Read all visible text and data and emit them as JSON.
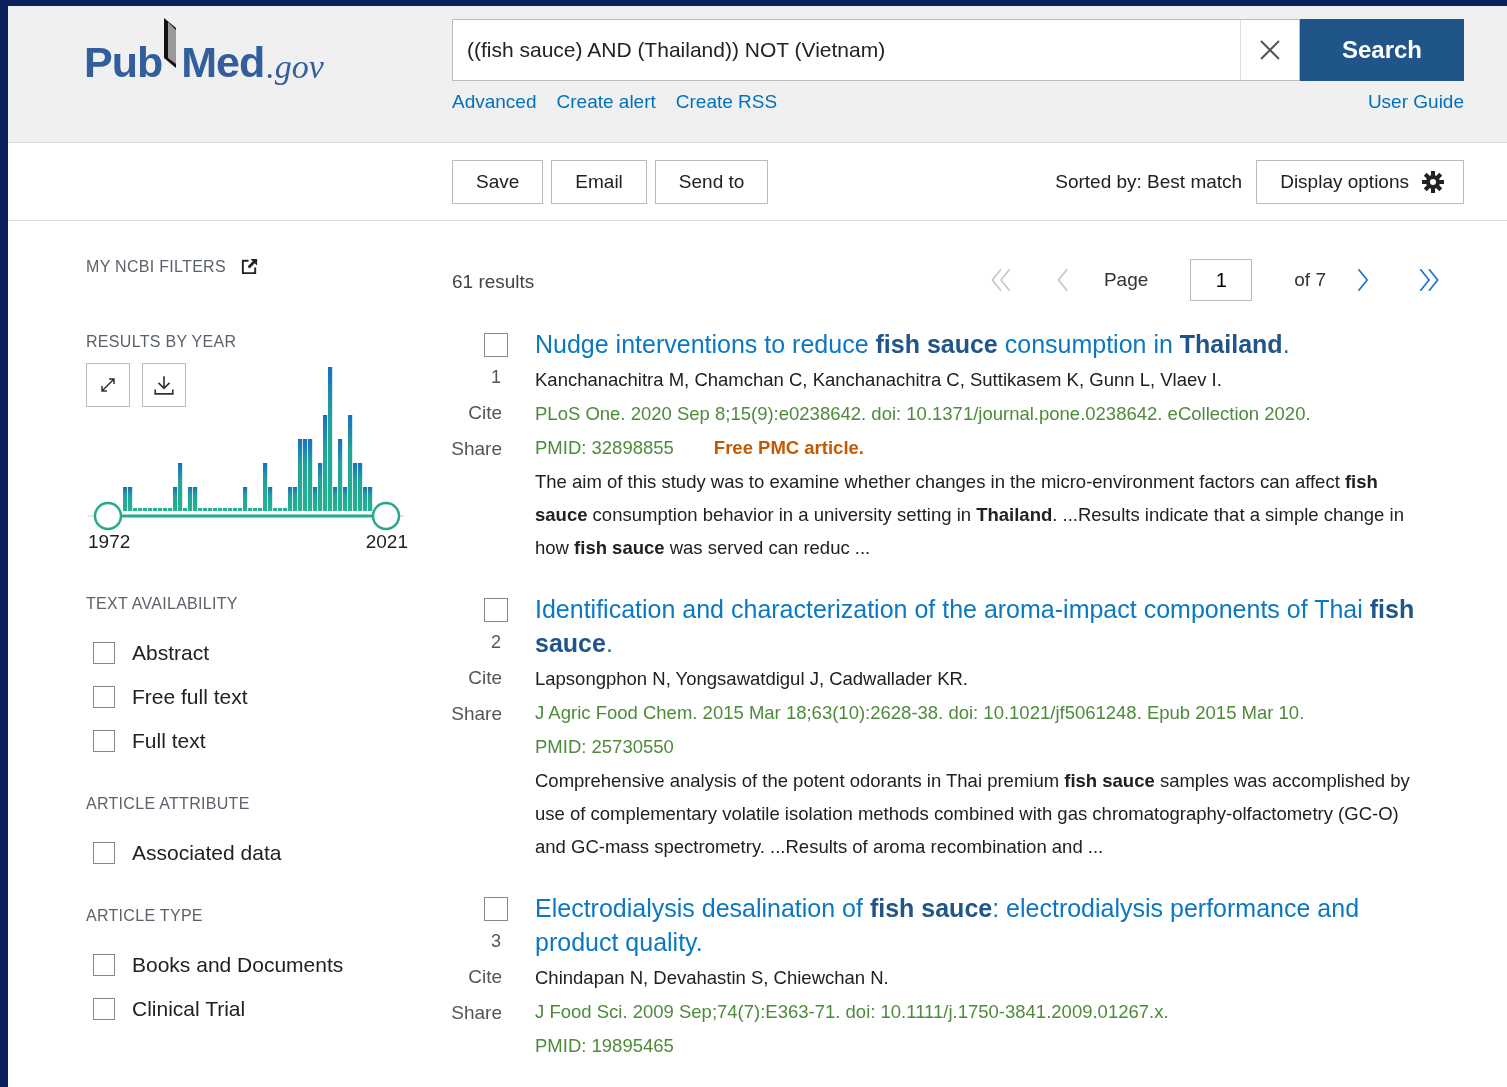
{
  "logo": {
    "part_a": "Pub",
    "part_b": "Med",
    "suffix": ".gov"
  },
  "search": {
    "value": "((fish sauce) AND (Thailand)) NOT (Vietnam)",
    "button": "Search",
    "links": [
      "Advanced",
      "Create alert",
      "Create RSS"
    ],
    "user_guide": "User Guide"
  },
  "toolbar": {
    "actions": [
      "Save",
      "Email",
      "Send to"
    ],
    "sort_label": "Sorted by: Best match",
    "display_options": "Display options"
  },
  "sidebar": {
    "my_ncbi_filters": "MY NCBI FILTERS",
    "results_by_year": {
      "heading": "RESULTS BY YEAR",
      "start_year": "1972",
      "end_year": "2021"
    },
    "sections": [
      {
        "heading": "TEXT AVAILABILITY",
        "filters": [
          {
            "label": "Abstract",
            "checked": false
          },
          {
            "label": "Free full text",
            "checked": false
          },
          {
            "label": "Full text",
            "checked": false
          }
        ]
      },
      {
        "heading": "ARTICLE ATTRIBUTE",
        "filters": [
          {
            "label": "Associated data",
            "checked": false
          }
        ]
      },
      {
        "heading": "ARTICLE TYPE",
        "filters": [
          {
            "label": "Books and Documents",
            "checked": false
          },
          {
            "label": "Clinical Trial",
            "checked": false
          }
        ]
      }
    ]
  },
  "results": {
    "count": "61 results",
    "pagination": {
      "page_label": "Page",
      "page_value": "1",
      "of": "of 7",
      "controls": [
        {
          "kind": "first",
          "disabled": true
        },
        {
          "kind": "prev",
          "disabled": true
        },
        {
          "kind": "next",
          "disabled": false
        },
        {
          "kind": "last",
          "disabled": false
        }
      ]
    },
    "items": [
      {
        "selected": false,
        "number": "1",
        "cite": "Cite",
        "share": "Share",
        "title": "Nudge interventions to reduce **fish sauce** consumption in **Thailand**.",
        "authors": "Kanchanachitra M, Chamchan C, Kanchanachitra C, Suttikasem K, Gunn L, Vlaev I.",
        "citation": "PLoS One. 2020 Sep 8;15(9):e0238642. doi: 10.1371/journal.pone.0238642. eCollection 2020.",
        "pmid": "PMID: 32898855",
        "free": "Free PMC article.",
        "snippet": "The aim of this study was to examine whether changes in the micro-environment factors can affect **fish sauce** consumption behavior in a university setting in **Thailand**. ...Results indicate that a simple change in how **fish sauce** was served can reduc ..."
      },
      {
        "selected": false,
        "number": "2",
        "cite": "Cite",
        "share": "Share",
        "title": "Identification and characterization of the aroma-impact components of Thai **fish sauce**.",
        "authors": "Lapsongphon N, Yongsawatdigul J, Cadwallader KR.",
        "citation": "J Agric Food Chem. 2015 Mar 18;63(10):2628-38. doi: 10.1021/jf5061248. Epub 2015 Mar 10.",
        "pmid": "PMID: 25730550",
        "snippet": "Comprehensive analysis of the potent odorants in Thai premium **fish sauce** samples was accomplished by use of complementary volatile isolation methods combined with gas chromatography-olfactometry (GC-O) and GC-mass spectrometry. ...Results of aroma recombination and ..."
      },
      {
        "selected": false,
        "number": "3",
        "cite": "Cite",
        "share": "Share",
        "title": "Electrodialysis desalination of **fish sauce**: electrodialysis performance and product quality.",
        "authors": "Chindapan N, Devahastin S, Chiewchan N.",
        "citation": "J Food Sci. 2009 Sep;74(7):E363-71. doi: 10.1111/j.1750-3841.2009.01267.x.",
        "pmid": "PMID: 19895465"
      }
    ]
  }
}
